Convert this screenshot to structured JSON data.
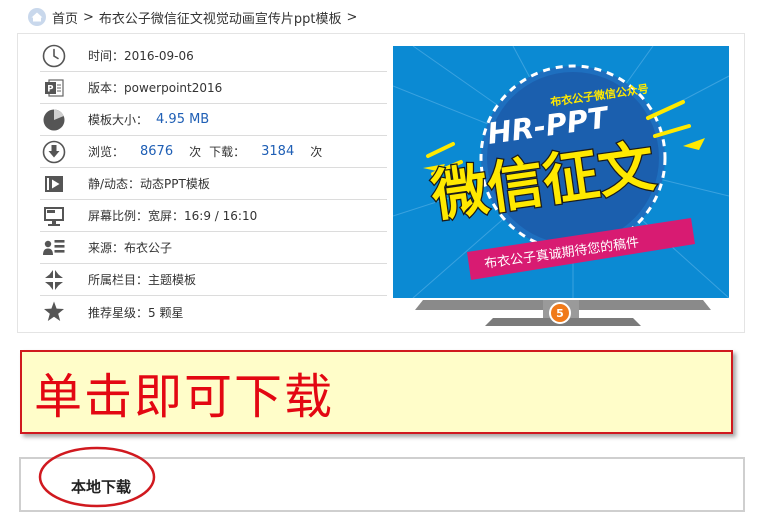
{
  "breadcrumb": {
    "home": "首页",
    "separator": ">",
    "title": "布衣公子微信征文视觉动画宣传片ppt模板",
    "trailing": ">"
  },
  "info": {
    "time_label": "时间：",
    "time_value": "2016-09-06",
    "version_label": "版本：",
    "version_value": "powerpoint2016",
    "size_label": "模板大小：",
    "size_value": "4.95 MB",
    "views_label": "浏览：",
    "views_value": "8676",
    "views_unit": "次",
    "downloads_label": "下载：",
    "downloads_value": "3184",
    "downloads_unit": "次",
    "type_label": "静/动态：",
    "type_value": "动态PPT模板",
    "ratio_label": "屏幕比例：",
    "ratio_value": "宽屏：16:9 / 16:10",
    "source_label": "来源：",
    "source_value": "布衣公子",
    "category_label": "所属栏目：",
    "category_value": "主题模板",
    "rating_label": "推荐星级：",
    "rating_value": "5 颗星"
  },
  "preview": {
    "top_text": "布衣公子微信公众号",
    "brand": "HR-PPT",
    "headline": "微信征文",
    "ribbon": "布衣公子真诚期待您的稿件",
    "stand_badge": "5"
  },
  "download": {
    "banner": "单击即可下载",
    "local": "本地下载"
  },
  "colors": {
    "accent_blue": "#1f5fb5",
    "screen_blue": "#0b8ad3",
    "headline_yellow": "#ffe900",
    "banner_red": "#e30712",
    "banner_bg": "#fffdc9"
  },
  "icons": {
    "home": "home-icon",
    "time": "clock-icon",
    "version": "powerpoint-icon",
    "size": "pie-chart-icon",
    "views": "download-arrow-icon",
    "type": "play-icon",
    "ratio": "monitor-icon",
    "source": "user-list-icon",
    "category": "arrows-inward-icon",
    "rating": "star-icon"
  }
}
